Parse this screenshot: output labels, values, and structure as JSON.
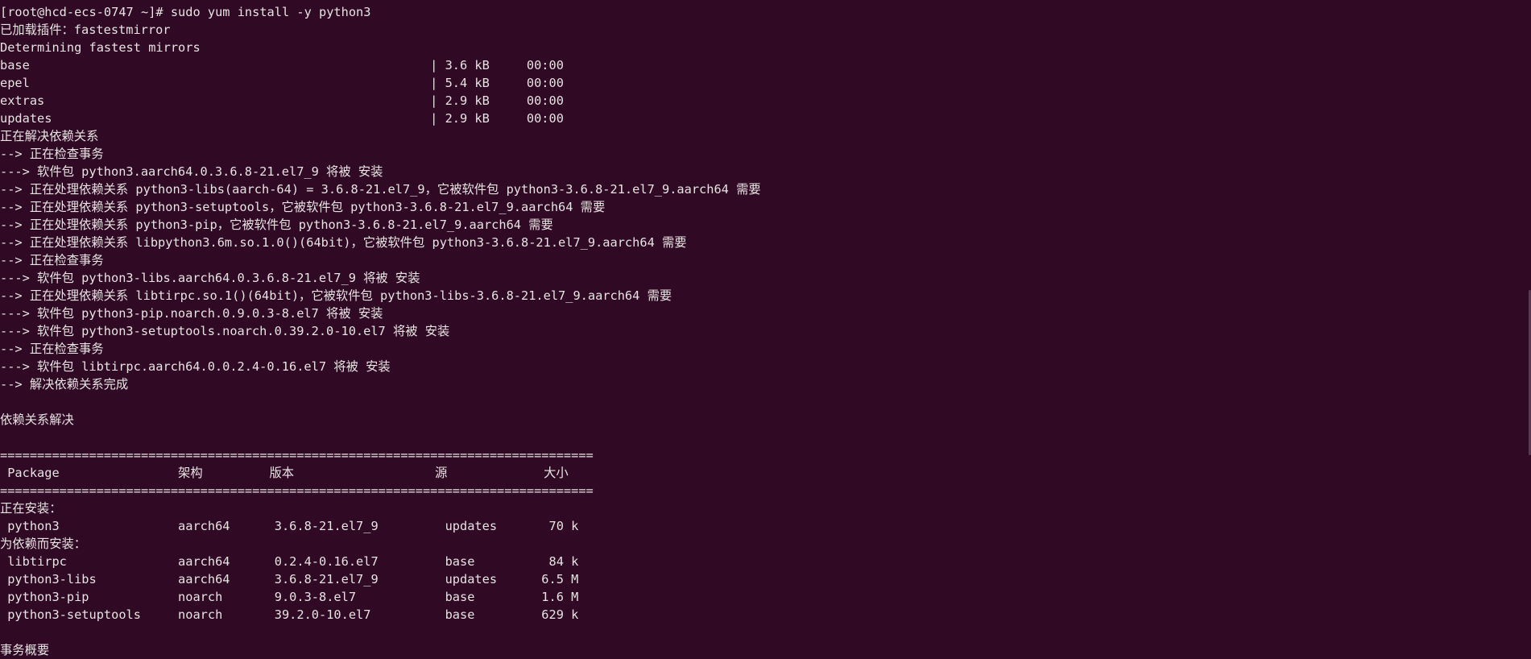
{
  "terminal": {
    "lines": [
      "[root@hcd-ecs-0747 ~]# sudo yum install -y python3",
      "已加载插件：fastestmirror",
      "Determining fastest mirrors",
      "base                                                      | 3.6 kB     00:00",
      "epel                                                      | 5.4 kB     00:00",
      "extras                                                    | 2.9 kB     00:00",
      "updates                                                   | 2.9 kB     00:00",
      "正在解决依赖关系",
      "--> 正在检查事务",
      "---> 软件包 python3.aarch64.0.3.6.8-21.el7_9 将被 安装",
      "--> 正在处理依赖关系 python3-libs(aarch-64) = 3.6.8-21.el7_9，它被软件包 python3-3.6.8-21.el7_9.aarch64 需要",
      "--> 正在处理依赖关系 python3-setuptools，它被软件包 python3-3.6.8-21.el7_9.aarch64 需要",
      "--> 正在处理依赖关系 python3-pip，它被软件包 python3-3.6.8-21.el7_9.aarch64 需要",
      "--> 正在处理依赖关系 libpython3.6m.so.1.0()(64bit)，它被软件包 python3-3.6.8-21.el7_9.aarch64 需要",
      "--> 正在检查事务",
      "---> 软件包 python3-libs.aarch64.0.3.6.8-21.el7_9 将被 安装",
      "--> 正在处理依赖关系 libtirpc.so.1()(64bit)，它被软件包 python3-libs-3.6.8-21.el7_9.aarch64 需要",
      "---> 软件包 python3-pip.noarch.0.9.0.3-8.el7 将被 安装",
      "---> 软件包 python3-setuptools.noarch.0.39.2.0-10.el7 将被 安装",
      "--> 正在检查事务",
      "---> 软件包 libtirpc.aarch64.0.0.2.4-0.16.el7 将被 安装",
      "--> 解决依赖关系完成",
      "",
      "依赖关系解决",
      "",
      "================================================================================",
      " Package                架构         版本                   源             大小",
      "================================================================================",
      "正在安装：",
      " python3                aarch64      3.6.8-21.el7_9         updates       70 k",
      "为依赖而安装：",
      " libtirpc               aarch64      0.2.4-0.16.el7         base          84 k",
      " python3-libs           aarch64      3.6.8-21.el7_9         updates      6.5 M",
      " python3-pip            noarch       9.0.3-8.el7            base         1.6 M",
      " python3-setuptools     noarch       39.2.0-10.el7          base         629 k",
      "",
      "事务概要"
    ]
  },
  "colors": {
    "background": "#300a24",
    "foreground": "#e7e3e3"
  }
}
